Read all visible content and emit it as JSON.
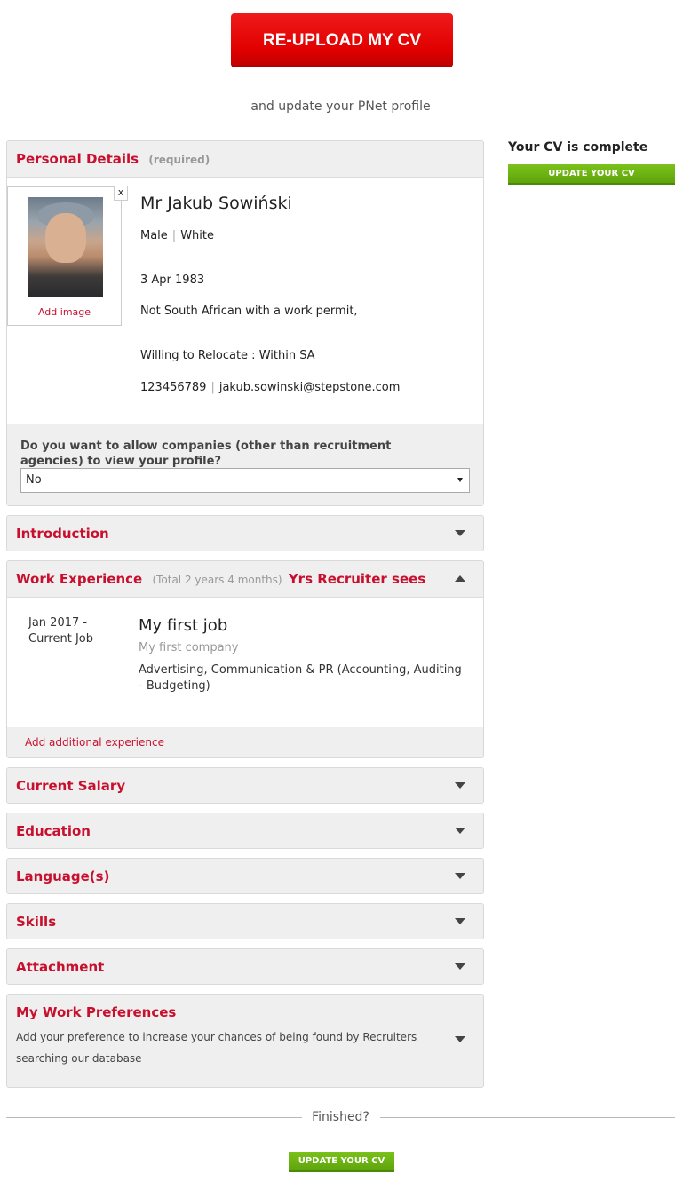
{
  "reupload_label": "RE-UPLOAD MY CV",
  "divider_text": "and update your PNet profile",
  "sidebar": {
    "status": "Your CV is complete",
    "update_label": "UPDATE YOUR CV"
  },
  "personal": {
    "title": "Personal Details",
    "required": "(required)",
    "close": "x",
    "add_image": "Add image",
    "name": "Mr Jakub Sowiński",
    "gender": "Male",
    "race": "White",
    "dob": "3 Apr 1983",
    "permit": "Not South African with a work permit,",
    "relocate": "Willing to Relocate : Within SA",
    "phone": "123456789",
    "email": "jakub.sowinski@stepstone.com",
    "visibility_question": "Do you want to allow companies (other than recruitment agencies) to view your profile?",
    "visibility_value": "No"
  },
  "introduction": {
    "title": "Introduction"
  },
  "work": {
    "title": "Work Experience",
    "total": "(Total 2 years 4 months)",
    "recruiter": "Yrs Recruiter sees",
    "job": {
      "date_start": "Jan 2017 -",
      "date_end": "Current Job",
      "title": "My first job",
      "company": "My first company",
      "industry": "Advertising, Communication & PR (Accounting, Auditing - Budgeting)"
    },
    "add_label": "Add additional experience"
  },
  "sections": {
    "salary": "Current Salary",
    "education": "Education",
    "languages": "Language(s)",
    "skills": "Skills",
    "attachment": "Attachment"
  },
  "preferences": {
    "title": "My Work Preferences",
    "description": "Add your preference to increase your chances of being found by Recruiters searching our database"
  },
  "finished_text": "Finished?",
  "bottom_update_label": "UPDATE YOUR CV",
  "colors": {
    "brand_red": "#c8102e",
    "button_red": "#e10000",
    "button_green": "#6cb412"
  }
}
